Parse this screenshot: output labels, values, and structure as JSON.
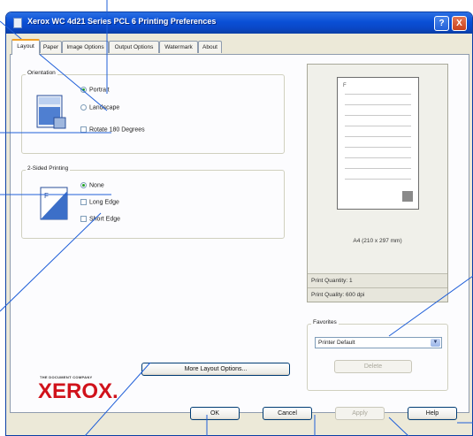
{
  "window": {
    "title": "Xerox WC 4d21 Series PCL 6 Printing Preferences"
  },
  "titlebar": {
    "help_glyph": "?",
    "close_glyph": "X"
  },
  "tabs": [
    {
      "label": "Layout"
    },
    {
      "label": "Paper"
    },
    {
      "label": "Image Options"
    },
    {
      "label": "Output Options"
    },
    {
      "label": "Watermark"
    },
    {
      "label": "About"
    }
  ],
  "orientation": {
    "legend": "Orientation",
    "portrait": "Portrait",
    "landscape": "Landscape",
    "rotate": "Rotate 180 Degrees",
    "selected": "portrait"
  },
  "two_sided": {
    "legend": "2-Sided Printing",
    "none": "None",
    "long_edge": "Long Edge",
    "short_edge": "Short Edge",
    "selected": "none"
  },
  "more_layout_label": "More Layout Options...",
  "logo": {
    "tagline": "THE DOCUMENT COMPANY",
    "word": "XEROX."
  },
  "preview": {
    "paper_size": "A4 (210 x 297 mm)",
    "print_quantity": "Print Quantity: 1",
    "print_quality": "Print Quality: 600 dpi"
  },
  "favorites": {
    "legend": "Favorites",
    "selected": "Printer Default",
    "delete_label": "Delete"
  },
  "footer": {
    "ok": "OK",
    "cancel": "Cancel",
    "apply": "Apply",
    "help": "Help"
  },
  "colors": {
    "titlebar": "#0a4fd6",
    "accent_tab": "#f2a023",
    "xerox_red": "#d0121b",
    "callout": "#1f5fd8"
  }
}
